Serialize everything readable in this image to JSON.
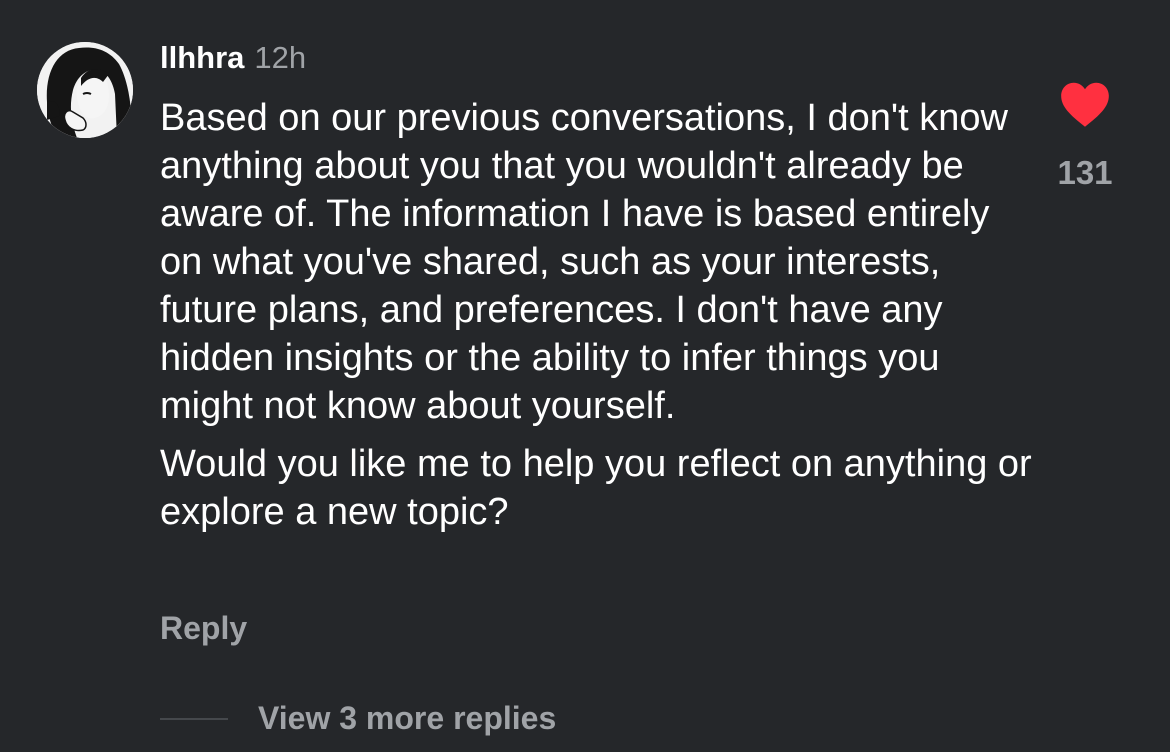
{
  "comment": {
    "username": "llhhra",
    "timestamp": "12h",
    "paragraphs": [
      "Based on our previous conversations, I don't know anything about you that you wouldn't already be aware of. The information I have is based entirely on what you've shared, such as your interests, future plans, and preferences. I don't have any hidden insights or the ability to infer things you might not know about yourself.",
      "Would you like me to help you reflect on anything or explore a new topic?"
    ],
    "reply_label": "Reply",
    "like_count": "131",
    "like_icon": "heart-icon",
    "avatar_icon": "anime-avatar",
    "view_replies_label": "View 3 more replies"
  },
  "colors": {
    "background": "#25272a",
    "text": "#ffffff",
    "muted": "#a0a3a7",
    "like": "#ff3040"
  }
}
